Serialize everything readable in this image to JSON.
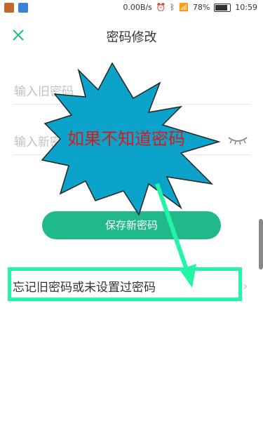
{
  "status_bar": {
    "speed": "0.00B/s",
    "battery": "78%",
    "battery_level": 0.78,
    "time": "10:59"
  },
  "header": {
    "title": "密码修改"
  },
  "form": {
    "old_password_placeholder": "输入旧密码",
    "new_password_placeholder": "输入新密码",
    "save_label": "保存新密码"
  },
  "forgot": {
    "label": "忘记旧密码或未设置过密码",
    "chevron": "›"
  },
  "annotation": {
    "callout_text": "如果不知道密码",
    "callout_color": "#0ba3c9",
    "text_color": "#d91a1a",
    "highlight_color": "#22f5a6",
    "arrow_color": "#22f5a6"
  },
  "colors": {
    "accent": "#20b989"
  }
}
